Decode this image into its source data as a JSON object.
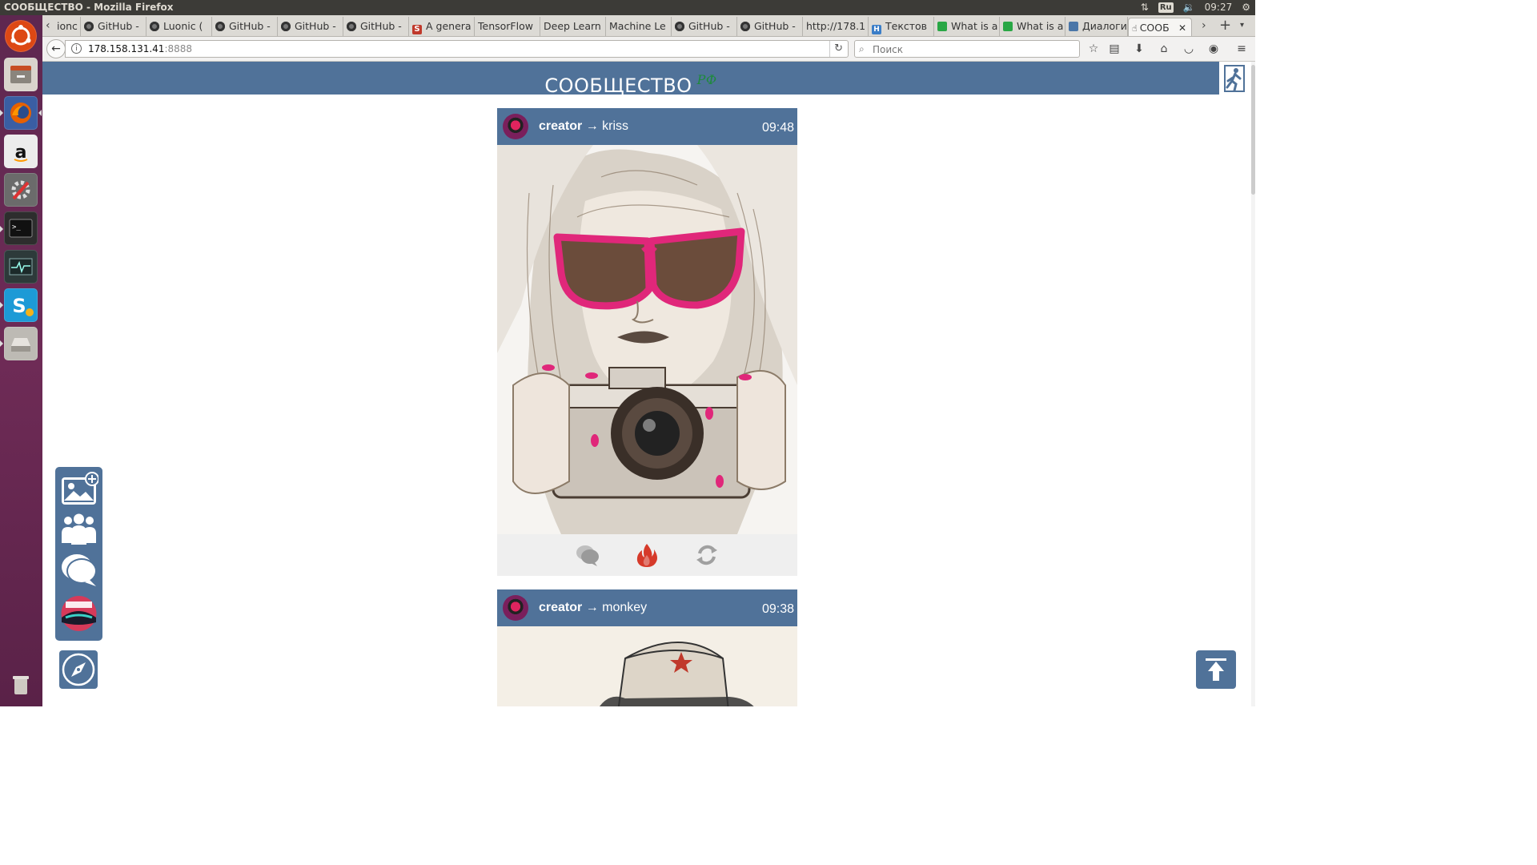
{
  "os": {
    "window_title": "СООБЩЕСТВО - Mozilla Firefox",
    "keyboard_layout": "Ru",
    "clock": "09:27"
  },
  "browser": {
    "tabs": [
      {
        "label": "ionc",
        "icon": "page-icon"
      },
      {
        "label": "GitHub -",
        "icon": "github-icon"
      },
      {
        "label": "Luonic (",
        "icon": "github-icon"
      },
      {
        "label": "GitHub -",
        "icon": "github-icon"
      },
      {
        "label": "GitHub -",
        "icon": "github-icon"
      },
      {
        "label": "GitHub -",
        "icon": "github-icon"
      },
      {
        "label": "A genera",
        "icon": "s-icon"
      },
      {
        "label": "TensorFlow",
        "icon": "none"
      },
      {
        "label": "Deep Learn",
        "icon": "none"
      },
      {
        "label": "Machine Le",
        "icon": "none"
      },
      {
        "label": "GitHub -",
        "icon": "github-icon"
      },
      {
        "label": "GitHub -",
        "icon": "github-icon"
      },
      {
        "label": "http://178.1",
        "icon": "none"
      },
      {
        "label": "Текстов",
        "icon": "h-icon"
      },
      {
        "label": "What is a",
        "icon": "quora-icon"
      },
      {
        "label": "What is a",
        "icon": "quora-icon"
      },
      {
        "label": "Диалоги",
        "icon": "vk-icon"
      },
      {
        "label": "СООБ",
        "icon": "hand-icon",
        "active": true
      }
    ],
    "url_host": "178.158.131.41",
    "url_port": ":8888",
    "search_placeholder": "Поиск"
  },
  "site": {
    "title": "СООБЩЕСТВО",
    "title_badge": "РФ",
    "header_color": "#507299"
  },
  "posts": [
    {
      "author": "creator",
      "arrow": "→",
      "recipient": "kriss",
      "time": "09:48"
    },
    {
      "author": "creator",
      "arrow": "→",
      "recipient": "monkey",
      "time": "09:38"
    }
  ],
  "side_menu": {
    "items": [
      "add-image-icon",
      "users-icon",
      "chat-icon",
      "avatar"
    ],
    "extra": "compass-icon"
  },
  "colors": {
    "accent": "#507299",
    "fire": "#d63a2a",
    "launcher": "#5e2750"
  }
}
